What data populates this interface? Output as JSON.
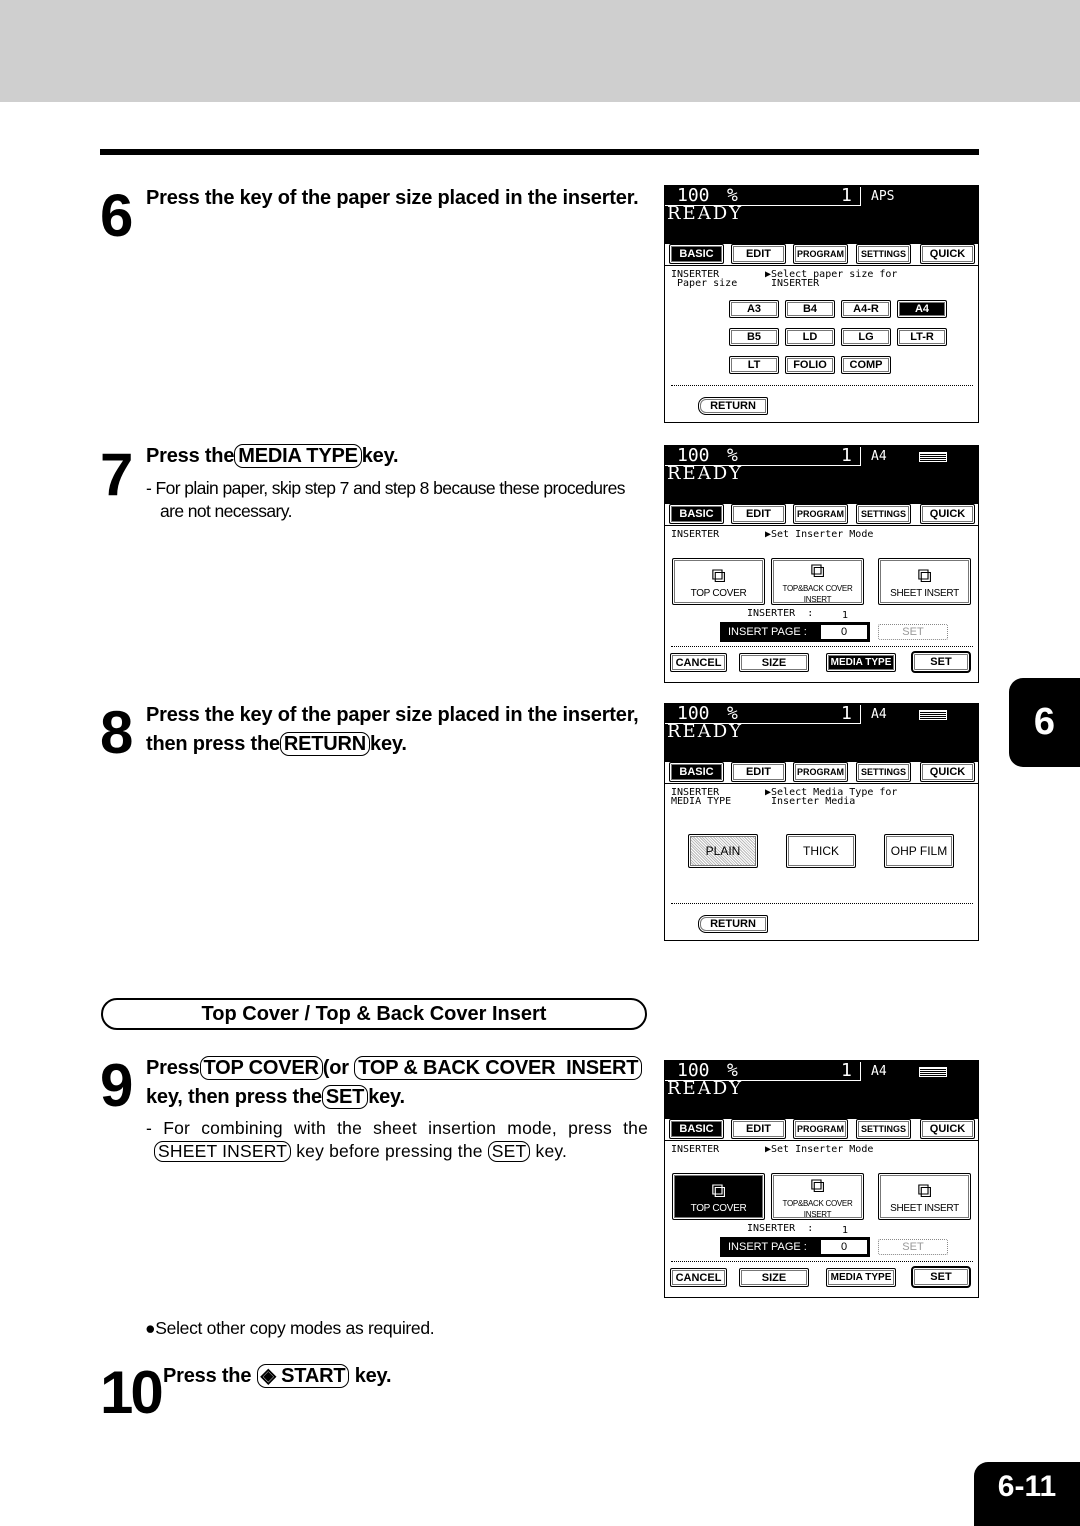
{
  "chapter_tab": "6",
  "page_number": "6-11",
  "steps": [
    {
      "num": "6",
      "heading": "Press the key of the paper size placed in the inserter."
    },
    {
      "num": "7",
      "heading_pre": "Press the",
      "key": "MEDIA TYPE",
      "heading_post": "key.",
      "note": "- For plain paper, skip step 7 and step 8 because these procedures are not necessary."
    },
    {
      "num": "8",
      "heading_line1": "Press the key of the paper size placed in the inserter,",
      "heading_pre": "then press the",
      "key": "RETURN",
      "heading_post": "key."
    },
    {
      "num": "9",
      "pre": "Press",
      "key1": "TOP COVER",
      "mid": "(or",
      "key2": "TOP & BACK COVER  INSERT",
      "line2_pre": "key, then press the",
      "key3": "SET",
      "line2_post": "key.",
      "note_pre": "- For combining with the sheet insertion mode, press the",
      "note_key1": "SHEET INSERT",
      "note_mid": "key before pressing the",
      "note_key2": "SET",
      "note_post": "key."
    },
    {
      "num": "10",
      "heading_pre": "Press the",
      "key": "START",
      "heading_post": "key."
    }
  ],
  "section_title": "Top Cover / Top & Back Cover Insert",
  "bullet_text": "Select other copy modes as required.",
  "bullet_icon": "filled-circle",
  "start_icon": "diamond-start-icon",
  "panels": [
    {
      "ratio": "100",
      "pct": "%",
      "count": "1",
      "paper": "APS",
      "paper_icon": false,
      "status": "READY",
      "tabs": [
        "BASIC",
        "EDIT",
        "PROGRAM",
        "SETTINGS",
        "QUICK"
      ],
      "active_tab": "BASIC",
      "info_left": "INSERTER\n Paper size",
      "info_right": "▶Select paper size for\n INSERTER",
      "paper_sizes": [
        "A3",
        "B4",
        "A4-R",
        "A4",
        "B5",
        "LD",
        "LG",
        "LT-R",
        "LT",
        "FOLIO",
        "COMP"
      ],
      "selected_size": "A4",
      "return_label": "RETURN"
    },
    {
      "ratio": "100",
      "pct": "%",
      "count": "1",
      "paper": "A4",
      "paper_icon": true,
      "status": "READY",
      "tabs": [
        "BASIC",
        "EDIT",
        "PROGRAM",
        "SETTINGS",
        "QUICK"
      ],
      "active_tab": "BASIC",
      "info_left": "INSERTER",
      "info_right": "▶Set Inserter Mode",
      "modes": [
        "TOP COVER",
        "TOP&BACK COVER INSERT",
        "SHEET INSERT"
      ],
      "selected_mode": "",
      "inserter_label": "INSERTER  :",
      "inserter_value": "1",
      "insert_page_label": "INSERT PAGE  :",
      "insert_page_value": "0",
      "set_ghost": "SET",
      "bottom": [
        "CANCEL",
        "SIZE",
        "MEDIA TYPE",
        "SET"
      ],
      "highlight_bottom": "MEDIA TYPE"
    },
    {
      "ratio": "100",
      "pct": "%",
      "count": "1",
      "paper": "A4",
      "paper_icon": true,
      "status": "READY",
      "tabs": [
        "BASIC",
        "EDIT",
        "PROGRAM",
        "SETTINGS",
        "QUICK"
      ],
      "active_tab": "BASIC",
      "info_left": "INSERTER\nMEDIA TYPE",
      "info_right": "▶Select Media Type for\n Inserter Media",
      "media": [
        "PLAIN",
        "THICK",
        "OHP FILM"
      ],
      "selected_media": "PLAIN",
      "return_label": "RETURN"
    },
    {
      "ratio": "100",
      "pct": "%",
      "count": "1",
      "paper": "A4",
      "paper_icon": true,
      "status": "READY",
      "tabs": [
        "BASIC",
        "EDIT",
        "PROGRAM",
        "SETTINGS",
        "QUICK"
      ],
      "active_tab": "BASIC",
      "info_left": "INSERTER",
      "info_right": "▶Set Inserter Mode",
      "modes": [
        "TOP COVER",
        "TOP&BACK COVER INSERT",
        "SHEET INSERT"
      ],
      "selected_mode": "TOP COVER",
      "inserter_label": "INSERTER  :",
      "inserter_value": "1",
      "insert_page_label": "INSERT PAGE  :",
      "insert_page_value": "0",
      "set_ghost": "SET",
      "bottom": [
        "CANCEL",
        "SIZE",
        "MEDIA TYPE",
        "SET"
      ],
      "highlight_bottom": ""
    }
  ]
}
